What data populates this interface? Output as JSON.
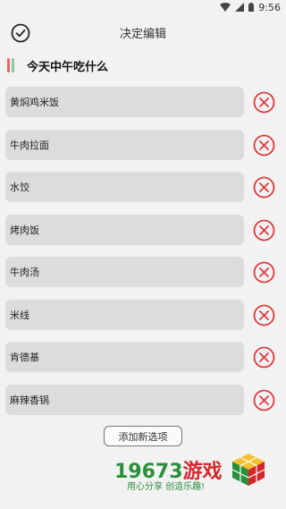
{
  "status": {
    "time": "9:56",
    "icons": [
      "wifi-icon",
      "signal-icon",
      "battery-icon"
    ]
  },
  "header": {
    "title": "决定编辑",
    "confirm_icon": "check-circle-icon"
  },
  "list": {
    "title": "今天中午吃什么"
  },
  "options": [
    {
      "label": "黄焖鸡米饭"
    },
    {
      "label": "牛肉拉面"
    },
    {
      "label": "水饺"
    },
    {
      "label": "烤肉饭"
    },
    {
      "label": "牛肉汤"
    },
    {
      "label": "米线"
    },
    {
      "label": "肯德基"
    },
    {
      "label": "麻辣香锅"
    }
  ],
  "delete_icon": "close-circle-icon",
  "add_button": {
    "label": "添加新选项"
  },
  "watermark": {
    "digits": "19673",
    "word": "游戏",
    "slogan": "用心分享 创造乐趣!"
  },
  "colors": {
    "accent_red": "#e0393e",
    "accent_green": "#8fc79a",
    "field_bg": "#dcdcdc",
    "page_bg": "#f2f2f2"
  }
}
